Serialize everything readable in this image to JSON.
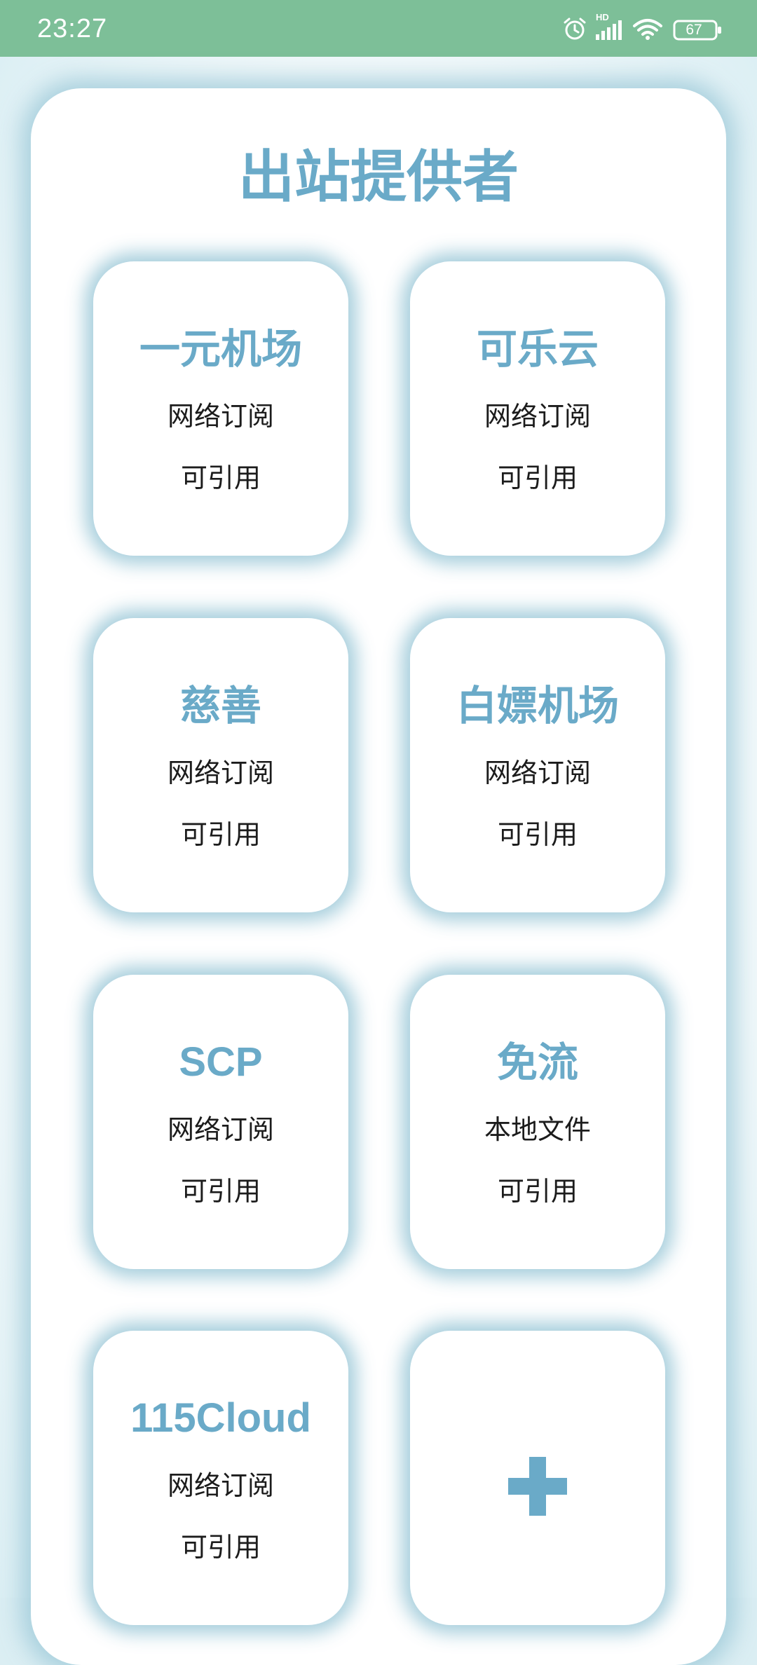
{
  "status_bar": {
    "time": "23:27",
    "battery_level": "67",
    "hd_label": "HD",
    "icons": [
      "alarm-icon",
      "cellular-signal-icon",
      "wifi-icon",
      "battery-icon"
    ]
  },
  "page": {
    "title": "出站提供者"
  },
  "providers": [
    {
      "name": "一元机场",
      "type": "网络订阅",
      "status": "可引用"
    },
    {
      "name": "可乐云",
      "type": "网络订阅",
      "status": "可引用"
    },
    {
      "name": "慈善",
      "type": "网络订阅",
      "status": "可引用"
    },
    {
      "name": "白嫖机场",
      "type": "网络订阅",
      "status": "可引用"
    },
    {
      "name": "SCP",
      "type": "网络订阅",
      "status": "可引用"
    },
    {
      "name": "免流",
      "type": "本地文件",
      "status": "可引用"
    },
    {
      "name": "115Cloud",
      "type": "网络订阅",
      "status": "可引用"
    }
  ],
  "add_card": {
    "icon": "plus-icon"
  },
  "colors": {
    "status_bar": "#7dbf98",
    "accent": "#6aaac8",
    "card_shadow": "#97c6d6",
    "text": "#1c1c1c"
  }
}
